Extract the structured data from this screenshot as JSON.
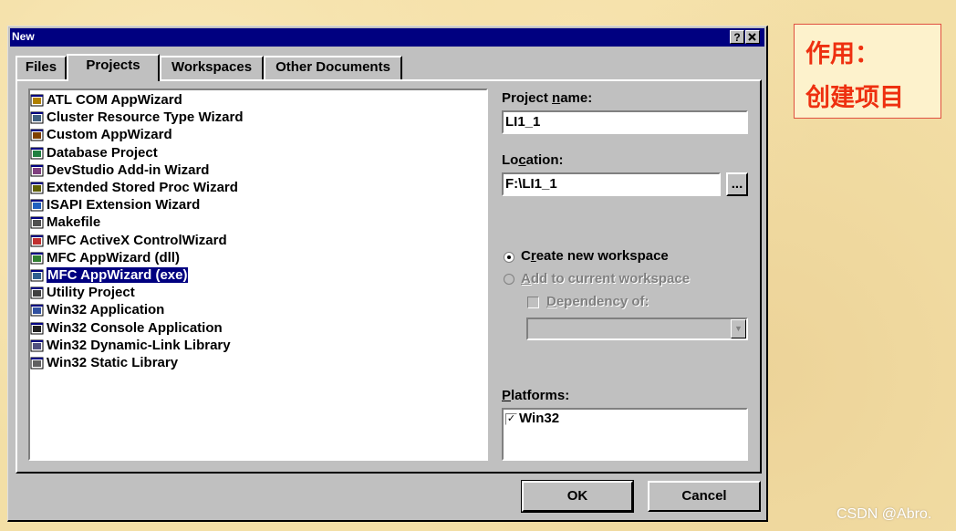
{
  "window": {
    "title": "New",
    "help_button": "?",
    "close_button": "x"
  },
  "tabs": [
    {
      "label": "Files",
      "active": false
    },
    {
      "label": "Projects",
      "active": true
    },
    {
      "label": "Workspaces",
      "active": false
    },
    {
      "label": "Other Documents",
      "active": false
    }
  ],
  "project_types": [
    {
      "label": "ATL COM AppWizard",
      "icon": "atl-wizard-icon"
    },
    {
      "label": "Cluster Resource Type Wizard",
      "icon": "cluster-wizard-icon"
    },
    {
      "label": "Custom AppWizard",
      "icon": "custom-wizard-icon"
    },
    {
      "label": "Database Project",
      "icon": "database-icon"
    },
    {
      "label": "DevStudio Add-in Wizard",
      "icon": "addin-wizard-icon"
    },
    {
      "label": "Extended Stored Proc Wizard",
      "icon": "stored-proc-icon"
    },
    {
      "label": "ISAPI Extension Wizard",
      "icon": "globe-icon"
    },
    {
      "label": "Makefile",
      "icon": "makefile-icon"
    },
    {
      "label": "MFC ActiveX ControlWizard",
      "icon": "activex-icon"
    },
    {
      "label": "MFC AppWizard (dll)",
      "icon": "mfc-dll-icon"
    },
    {
      "label": "MFC AppWizard (exe)",
      "icon": "mfc-exe-icon",
      "selected": true
    },
    {
      "label": "Utility Project",
      "icon": "tools-icon"
    },
    {
      "label": "Win32 Application",
      "icon": "win32-app-icon"
    },
    {
      "label": "Win32 Console Application",
      "icon": "console-icon"
    },
    {
      "label": "Win32 Dynamic-Link Library",
      "icon": "dll-icon"
    },
    {
      "label": "Win32 Static Library",
      "icon": "static-lib-icon"
    }
  ],
  "project_name": {
    "label_pre": "Project ",
    "label_key": "n",
    "label_post": "ame:",
    "value": "LI1_1"
  },
  "location": {
    "label_pre": "Lo",
    "label_key": "c",
    "label_post": "ation:",
    "value": "F:\\LI1_1",
    "browse": "..."
  },
  "workspace": {
    "create": {
      "label_pre": "C",
      "label_key": "r",
      "label_post": "eate new workspace",
      "selected": true
    },
    "add": {
      "label_key": "A",
      "label_post": "dd to current workspace",
      "enabled": false
    },
    "dependency": {
      "label_key": "D",
      "label_post": "ependency of:",
      "enabled": false,
      "checked": false
    }
  },
  "platforms": {
    "label_key": "P",
    "label_post": "latforms:",
    "items": [
      {
        "label": "Win32",
        "checked": true
      }
    ]
  },
  "buttons": {
    "ok": "OK",
    "cancel": "Cancel"
  },
  "annotation": {
    "line1": "作用：",
    "line2": "创建项目"
  },
  "watermark": "CSDN @Abro.",
  "colors": {
    "title_bar": "#000080",
    "dialog_bg": "#c0c0c0",
    "selection": "#000080",
    "annotation_text": "#ee3010"
  }
}
